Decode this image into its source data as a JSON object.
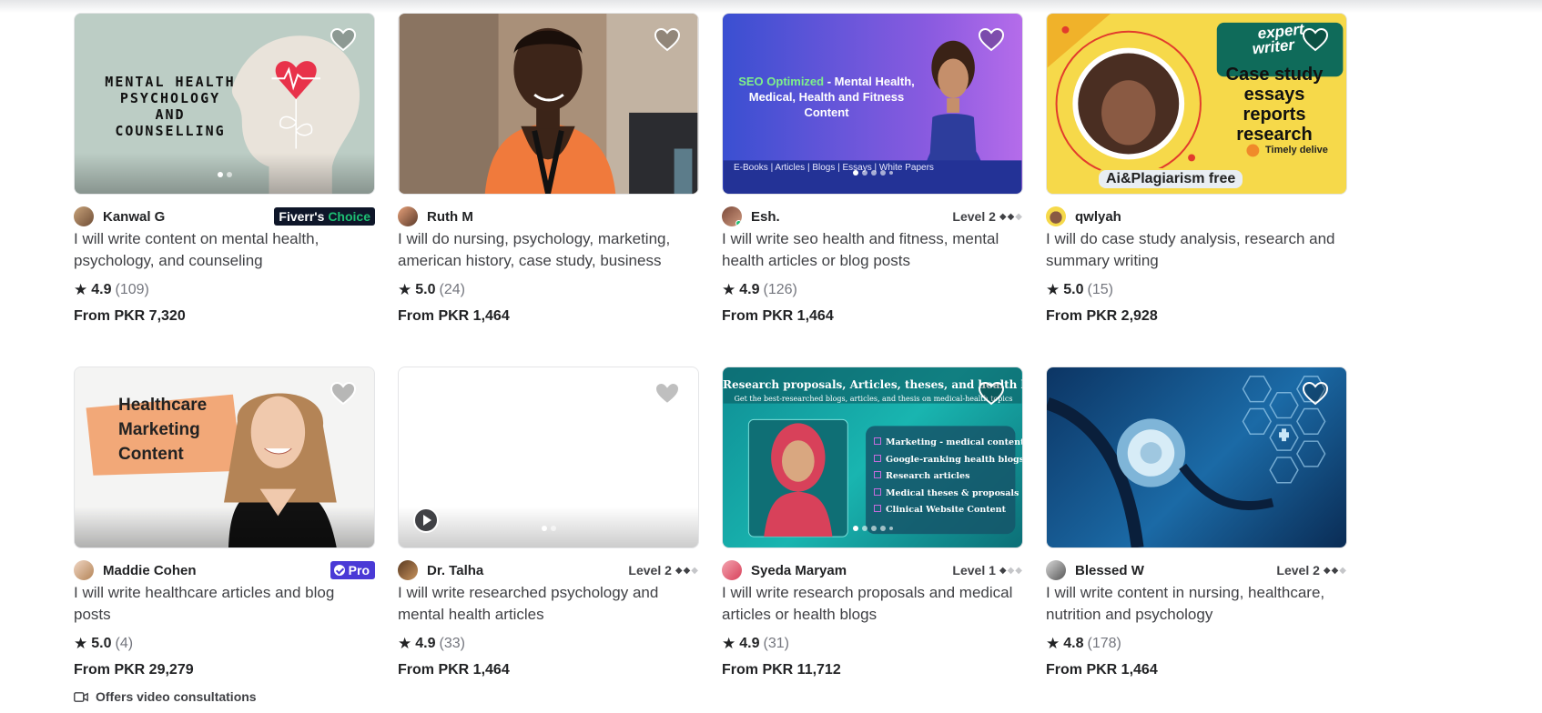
{
  "colors": {
    "accent_green": "#1dbf73",
    "pro_purple": "#4a3ad6",
    "choice_navy": "#0e1629"
  },
  "gigs": [
    {
      "seller": "Kanwal G",
      "badge": {
        "type": "choice",
        "prefix": "Fiverr's",
        "label": "Choice"
      },
      "title": "I will write content on mental health, psychology, and counseling",
      "rating": "4.9",
      "reviews": "(109)",
      "price": "From PKR 7,320",
      "thumb_text": [
        "MENTAL HEALTH",
        "PSYCHOLOGY",
        "AND",
        "COUNSELLING"
      ],
      "slides": 2,
      "active_slide": 0
    },
    {
      "seller": "Ruth M",
      "title": "I will do nursing, psychology, marketing, american history, case study, business",
      "rating": "5.0",
      "reviews": "(24)",
      "price": "From PKR 1,464"
    },
    {
      "seller": "Esh.",
      "badge": {
        "type": "level",
        "label": "Level 2",
        "filled": 2,
        "total": 3
      },
      "online": true,
      "title": "I will write seo health and fitness, mental health articles or blog posts",
      "rating": "4.9",
      "reviews": "(126)",
      "price": "From PKR 1,464",
      "thumb_text": {
        "highlight": "SEO Optimized",
        "rest": " - Mental Health, Medical, Health and Fitness Content",
        "footer": "E-Books | Articles | Blogs | Essays | White Papers"
      },
      "slides": 5,
      "active_slide": 0
    },
    {
      "seller": "qwlyah",
      "title": "I will do case study analysis, research and summary writing",
      "rating": "5.0",
      "reviews": "(15)",
      "price": "From PKR 2,928",
      "thumb_text": {
        "tag": [
          "expert",
          "writer"
        ],
        "lines": [
          "Case study",
          "essays",
          "reports",
          "research"
        ],
        "timely": "Timely delive",
        "banner": "Ai&Plagiarism free"
      }
    },
    {
      "seller": "Maddie Cohen",
      "badge": {
        "type": "pro",
        "label": "Pro"
      },
      "title": "I will write healthcare articles and blog posts",
      "rating": "5.0",
      "reviews": "(4)",
      "price": "From PKR 29,279",
      "consult": "Offers video consultations",
      "thumb_text": [
        "Healthcare",
        "Marketing",
        "Content"
      ]
    },
    {
      "seller": "Dr. Talha",
      "badge": {
        "type": "level",
        "label": "Level 2",
        "filled": 2,
        "total": 3
      },
      "title": "I will write researched psychology and mental health articles",
      "rating": "4.9",
      "reviews": "(33)",
      "price": "From PKR 1,464",
      "slides": 2,
      "active_slide": 0,
      "has_video": true
    },
    {
      "seller": "Syeda Maryam",
      "badge": {
        "type": "level",
        "label": "Level 1",
        "filled": 1,
        "total": 3
      },
      "title": "I will write research proposals and medical articles or health blogs",
      "rating": "4.9",
      "reviews": "(31)",
      "price": "From PKR 11,712",
      "thumb_text": {
        "heading": "Research proposals, Articles, theses, and health blogs",
        "sub": "Get the best-researched blogs, articles, and thesis on medical-health topics",
        "items": [
          "Marketing - medical content",
          "Google-ranking health blogs",
          "Research articles",
          "Medical theses & proposals",
          "Clinical Website Content"
        ]
      },
      "slides": 5,
      "active_slide": 0
    },
    {
      "seller": "Blessed W",
      "badge": {
        "type": "level",
        "label": "Level 2",
        "filled": 2,
        "total": 3
      },
      "title": "I will write content in nursing, healthcare, nutrition and psychology",
      "rating": "4.8",
      "reviews": "(178)",
      "price": "From PKR 1,464"
    }
  ]
}
